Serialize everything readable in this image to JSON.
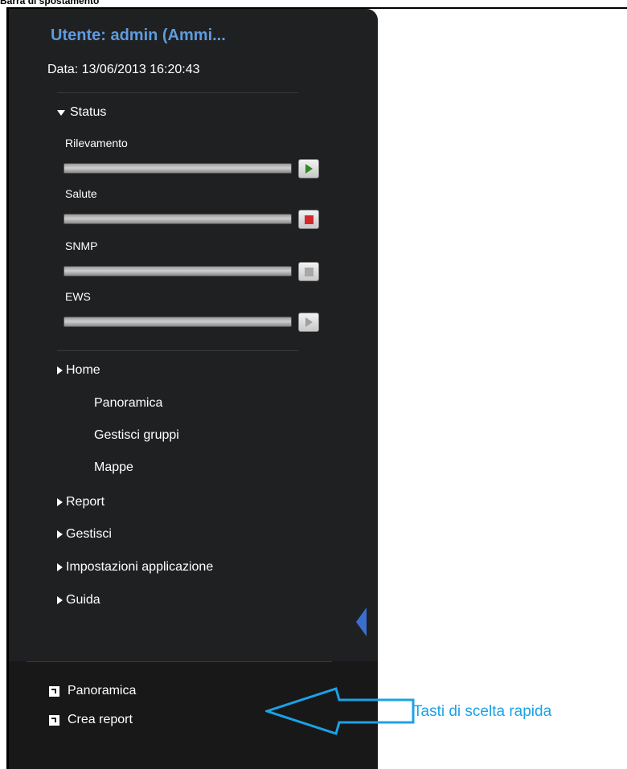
{
  "caption": "Barra di spostamento",
  "user": "Utente: admin (Ammi...",
  "date": "Data: 13/06/2013 16:20:43",
  "status_section": "Status",
  "services": [
    {
      "name": "Rilevamento",
      "icon": "play-green-icon"
    },
    {
      "name": "Salute",
      "icon": "stop-red-icon"
    },
    {
      "name": "SNMP",
      "icon": "stop-gray-icon"
    },
    {
      "name": "EWS",
      "icon": "play-gray-icon"
    }
  ],
  "nav": {
    "home": "Home",
    "home_items": [
      "Panoramica",
      "Gestisci gruppi",
      "Mappe"
    ],
    "report": "Report",
    "gestisci": "Gestisci",
    "impostazioni": "Impostazioni applicazione",
    "guida": "Guida"
  },
  "shortcuts": [
    "Panoramica",
    "Crea report"
  ],
  "annotation": "Tasti di scelta rapida",
  "colors": {
    "panel": "#1f2022",
    "user_text": "#5f9bdd",
    "annotation": "#1aa3e6"
  }
}
